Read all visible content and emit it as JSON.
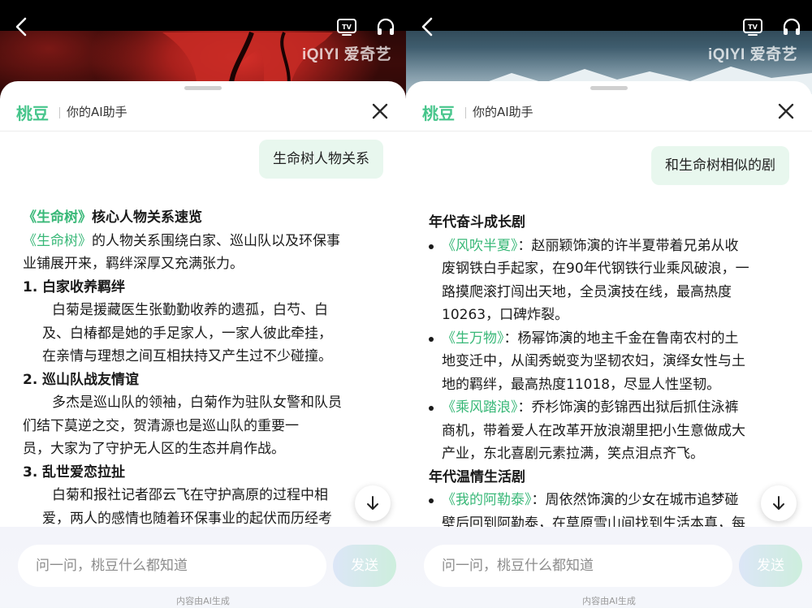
{
  "common": {
    "watermark": "iQIYI 爱奇艺",
    "brand": "桃豆",
    "subtitle": "你的AI助手",
    "input_placeholder": "问一问，桃豆什么都知道",
    "send_label": "发送",
    "ai_note": "内容由AI生成",
    "colors": {
      "brand_green": "#46c58b",
      "title_green": "#39b878",
      "bubble_bg": "#e8f7ee"
    },
    "icons": [
      "back-icon",
      "tv-icon",
      "headphones-icon",
      "close-icon",
      "arrow-down-icon"
    ]
  },
  "left": {
    "user_question": "生命树人物关系",
    "title_work": "《生命树》",
    "title_rest": "核心人物关系速览",
    "intro_work": "《生命树》",
    "intro_line1": "的人物关系围绕白家、巡山队以及环保事",
    "intro_line2": "业铺展开来，羁绊深厚又充满张力。",
    "sections": [
      {
        "num": "1.",
        "heading": "白家收养羁绊",
        "lines": [
          "白菊是援藏医生张勤勤收养的遗孤，白芍、白",
          "及、白椿都是她的手足家人，一家人彼此牵挂，",
          "在亲情与理想之间互相扶持又产生过不少碰撞。"
        ]
      },
      {
        "num": "2.",
        "heading": "巡山队战友情谊",
        "lines": [
          "多杰是巡山队的领袖，白菊作为驻队女警和队员",
          "们结下莫逆之交，贺清源也是巡山队的重要一",
          "员，大家为了守护无人区的生态并肩作战。"
        ]
      },
      {
        "num": "3.",
        "heading": "乱世爱恋拉扯",
        "lines": [
          "白菊和报社记者邵云飞在守护高原的过程中相",
          "爱，两人的感情也随着环保事业的起伏而历经考"
        ]
      }
    ]
  },
  "right": {
    "user_question": "和生命树相似的剧",
    "categories": [
      {
        "title": "年代奋斗成长剧",
        "items": [
          {
            "work": "《风吹半夏》",
            "lines": [
              "：赵丽颖饰演的许半夏带着兄弟从收",
              "废钢铁白手起家，在90年代钢铁行业乘风破浪，一",
              "路摸爬滚打闯出天地，全员演技在线，最高热度",
              "10263，口碑炸裂。"
            ]
          },
          {
            "work": "《生万物》",
            "lines": [
              "：杨幂饰演的地主千金在鲁南农村的土",
              "地变迁中，从闺秀蜕变为坚韧农妇，演绎女性与土",
              "地的羁绊，最高热度11018，尽显人性坚韧。"
            ]
          },
          {
            "work": "《乘风踏浪》",
            "lines": [
              "：乔杉饰演的彭锦西出狱后抓住泳裤",
              "商机，带着爱人在改革开放浪潮里把小生意做成大",
              "产业，东北喜剧元素拉满，笑点泪点齐飞。"
            ]
          }
        ]
      },
      {
        "title": "年代温情生活剧",
        "items": [
          {
            "work": "《我的阿勒泰》",
            "lines": [
              "：周依然饰演的少女在城市追梦碰",
              "壁后回到阿勒泰，在草原雪山间找到生活本真，每"
            ]
          }
        ]
      }
    ]
  }
}
